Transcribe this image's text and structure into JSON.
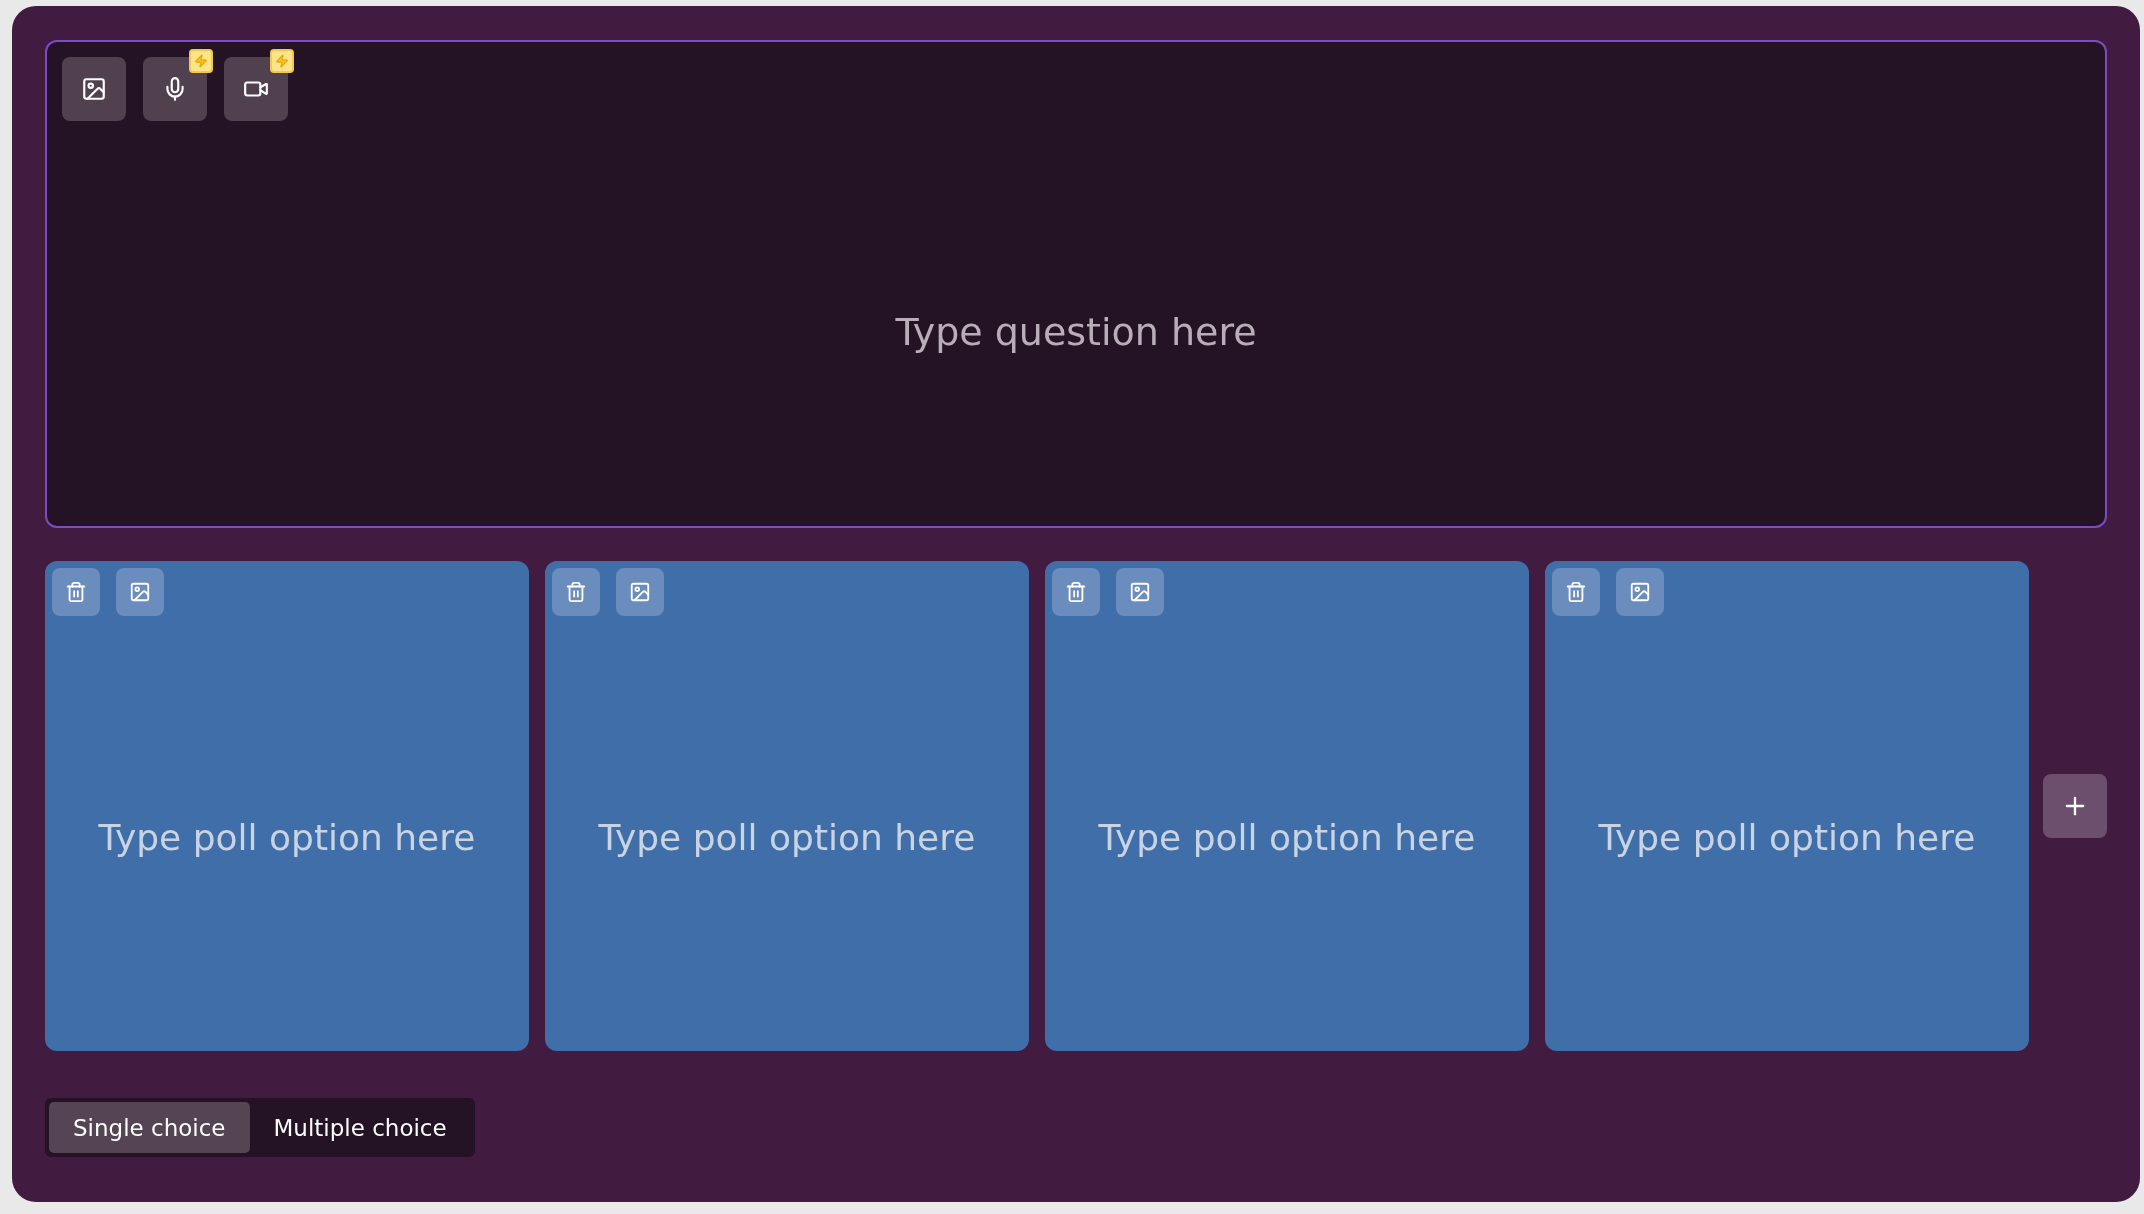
{
  "question": {
    "placeholder": "Type question here",
    "media_buttons": [
      {
        "kind": "image",
        "premium": false
      },
      {
        "kind": "audio",
        "premium": true
      },
      {
        "kind": "video",
        "premium": true
      }
    ]
  },
  "options": [
    {
      "placeholder": "Type poll option here"
    },
    {
      "placeholder": "Type poll option here"
    },
    {
      "placeholder": "Type poll option here"
    },
    {
      "placeholder": "Type poll option here"
    }
  ],
  "choice_mode": [
    {
      "label": "Single choice",
      "selected": true
    },
    {
      "label": "Multiple choice",
      "selected": false
    }
  ]
}
